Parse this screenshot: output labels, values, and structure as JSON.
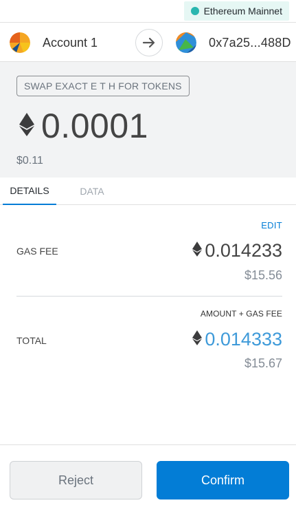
{
  "network": {
    "label": "Ethereum Mainnet",
    "dot_color": "#29b6af"
  },
  "accounts": {
    "from_name": "Account 1",
    "to_address": "0x7a25...488D",
    "arrow_icon": "arrow-right-icon"
  },
  "summary": {
    "method": "SWAP EXACT E T H FOR TOKENS",
    "amount": "0.0001",
    "fiat": "$0.11",
    "currency_icon": "ethereum-icon"
  },
  "tabs": [
    {
      "label": "DETAILS",
      "active": true
    },
    {
      "label": "DATA",
      "active": false
    }
  ],
  "details": {
    "edit_label": "EDIT",
    "gas_fee": {
      "label": "GAS FEE",
      "eth": "0.014233",
      "fiat": "$15.56"
    },
    "subheading": "AMOUNT + GAS FEE",
    "total": {
      "label": "TOTAL",
      "eth": "0.014333",
      "fiat": "$15.67"
    }
  },
  "footer": {
    "reject_label": "Reject",
    "confirm_label": "Confirm"
  },
  "colors": {
    "accent": "#037dd6",
    "total": "#3e9ad9",
    "summary_bg": "#f2f3f4"
  }
}
